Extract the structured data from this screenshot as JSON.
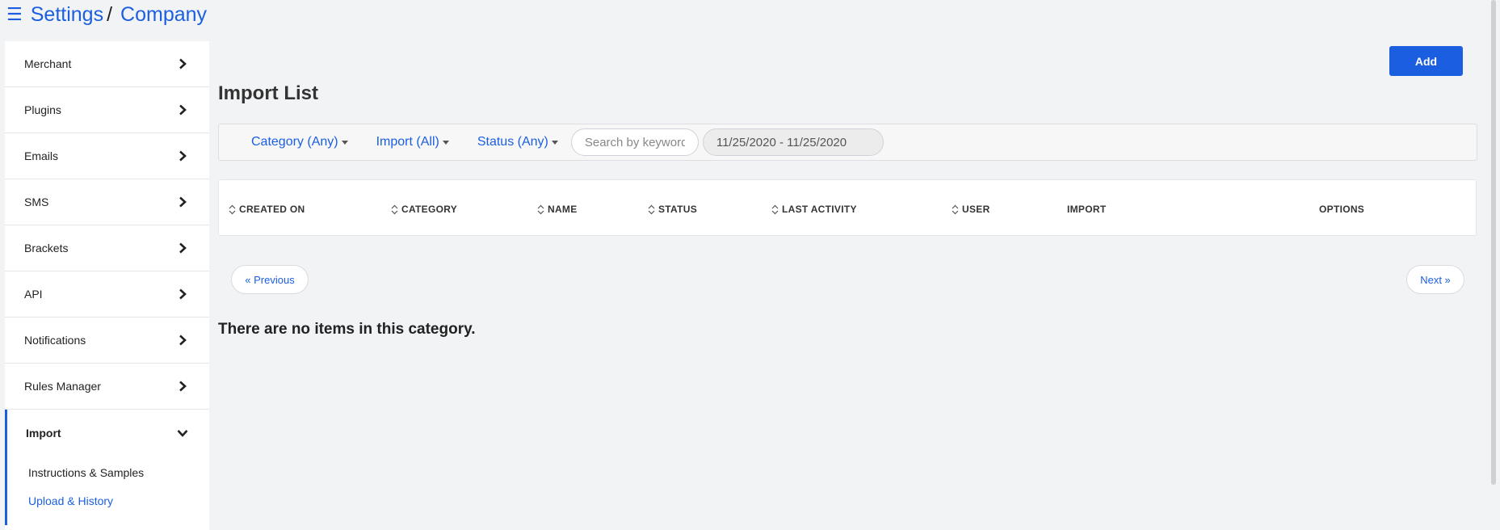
{
  "breadcrumb": {
    "menu_icon": "hamburger-icon",
    "root": "Settings",
    "separator": "/",
    "current": "Company"
  },
  "sidebar": {
    "items": [
      {
        "label": "Merchant"
      },
      {
        "label": "Plugins"
      },
      {
        "label": "Emails"
      },
      {
        "label": "SMS"
      },
      {
        "label": "Brackets"
      },
      {
        "label": "API"
      },
      {
        "label": "Notifications"
      },
      {
        "label": "Rules Manager"
      },
      {
        "label": "Import"
      }
    ],
    "import_sub": [
      "Instructions & Samples",
      "Upload & History"
    ]
  },
  "main": {
    "add_label": "Add",
    "title": "Import List",
    "filters": {
      "category": "Category (Any)",
      "import": "Import (All)",
      "status": "Status (Any)",
      "search_placeholder": "Search by keyword",
      "date_range": "11/25/2020 - 11/25/2020"
    },
    "table": {
      "columns": [
        "CREATED ON",
        "CATEGORY",
        "NAME",
        "STATUS",
        "LAST ACTIVITY",
        "USER",
        "IMPORT",
        "OPTIONS"
      ]
    },
    "pagination": {
      "prev": "« Previous",
      "next": "Next »"
    },
    "empty_message": "There are no items in this category."
  },
  "colors": {
    "accent": "#1b5fe0",
    "background": "#f2f3f5"
  }
}
